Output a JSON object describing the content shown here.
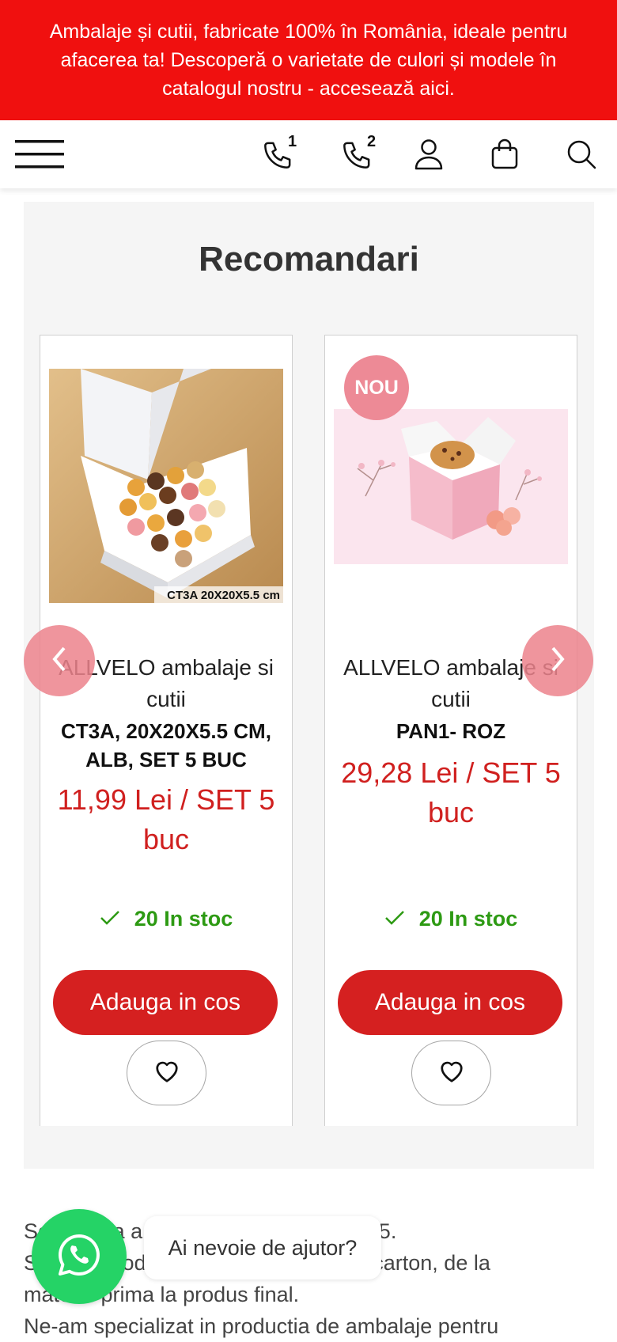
{
  "promo": {
    "text": "Ambalaje și cutii, fabricate 100% în România, ideale pentru afacerea ta! Descoperă o varietate de culori și modele în catalogul nostru - accesează aici."
  },
  "nav": {
    "icons": [
      "menu-icon",
      "phone-icon",
      "phone-icon",
      "user-icon",
      "cart-icon",
      "search-icon"
    ],
    "phone1_label": "1",
    "phone2_label": "2"
  },
  "recommendations": {
    "title": "Recomandari",
    "products": [
      {
        "brand": "ALLVELO ambalaje si cutii",
        "name": "CT3A, 20X20X5.5 CM, ALB, SET 5 BUC",
        "image_caption": "CT3A 20X20X5.5 cm",
        "price": "11,99 Lei / SET 5 buc",
        "stock": "20 In stoc",
        "add_label": "Adauga in cos",
        "badge": ""
      },
      {
        "brand": "ALLVELO ambalaje si cutii",
        "name": "PAN1- ROZ",
        "image_caption": "",
        "price": "29,28 Lei / SET 5 buc",
        "stock": "20 In stoc",
        "add_label": "Adauga in cos",
        "badge": "NOU"
      }
    ]
  },
  "about": {
    "line1": "Societatea a fost infiintata in anul 2015.",
    "line2": "Suntem producatori de ambalaje din carton, de la",
    "line3": "materie prima la produs final.",
    "line4": "Ne-am specializat in productia de ambalaje pentru"
  },
  "chat": {
    "help_text": "Ai nevoie de ajutor?"
  },
  "colors": {
    "promo_bg": "#f0100f",
    "price": "#d0201f",
    "button": "#d52020",
    "stock": "#2d9a13",
    "badge": "#ed8a96",
    "whatsapp": "#25d366"
  }
}
